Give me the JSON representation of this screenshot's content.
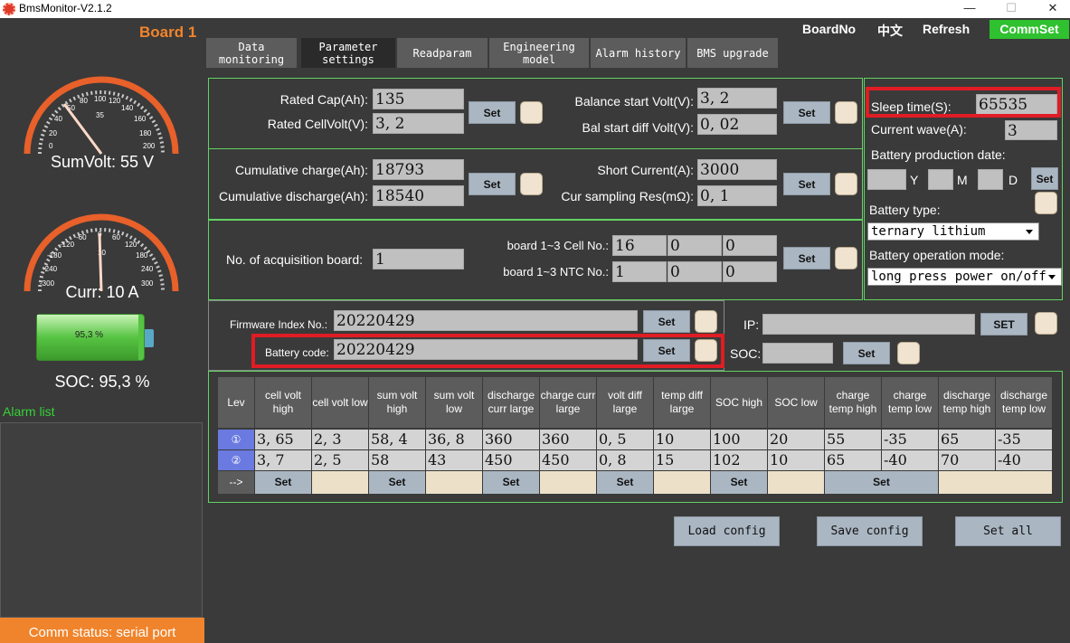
{
  "titlebar": {
    "title": "BmsMonitor-V2.1.2",
    "min": "—",
    "max": "☐",
    "close": "✕"
  },
  "board_label": "Board 1",
  "gauge_volt": {
    "ticks": [
      "0",
      "20",
      "40",
      "50",
      "80",
      "100",
      "120",
      "140",
      "160",
      "180",
      "200",
      "35"
    ],
    "label": "SumVolt: 55 V",
    "value": 55
  },
  "gauge_curr": {
    "ticks": [
      "-300",
      "-240",
      "-180",
      "-120",
      "-60",
      "0",
      "60",
      "120",
      "180",
      "240",
      "300",
      "10"
    ],
    "label": "Curr: 10 A",
    "value": 10
  },
  "battery": {
    "text": "95,3 %",
    "label": "SOC: 95,3 %",
    "level": 0.953
  },
  "alarm_list_label": "Alarm list",
  "comm_status": "Comm status: serial port",
  "tabs": [
    "Data monitoring",
    "Parameter settings",
    "Readparam",
    "Engineering model",
    "Alarm history",
    "BMS upgrade"
  ],
  "top_buttons": {
    "boardno": "BoardNo",
    "lang": "中文",
    "refresh": "Refresh",
    "commset": "CommSet"
  },
  "colors": {
    "accent_orange": "#f0842c",
    "panel_green": "#63d363",
    "alarm_red": "#e01c24",
    "commset_green": "#2fc12f"
  },
  "p1": {
    "rated_cap_label": "Rated Cap(Ah):",
    "rated_cap": "135",
    "rated_cellvolt_label": "Rated CellVolt(V):",
    "rated_cellvolt": "3, 2",
    "bal_start_label": "Balance start Volt(V):",
    "bal_start": "3, 2",
    "bal_diff_label": "Bal start diff Volt(V):",
    "bal_diff": "0, 02"
  },
  "p2": {
    "cum_charge_label": "Cumulative charge(Ah):",
    "cum_charge": "18793",
    "cum_discharge_label": "Cumulative discharge(Ah):",
    "cum_discharge": "18540",
    "short_label": "Short Current(A):",
    "short": "3000",
    "cursamp_label": "Cur sampling Res(mΩ):",
    "cursamp": "0, 1"
  },
  "p3": {
    "acq_label": "No. of acquisition board:",
    "acq": "1",
    "cellno_label": "board 1~3 Cell No.:",
    "cellno": [
      "16",
      "0",
      "0"
    ],
    "ntcno_label": "board 1~3 NTC No.:",
    "ntcno": [
      "1",
      "0",
      "0"
    ]
  },
  "right": {
    "sleep_label": "Sleep time(S):",
    "sleep": "65535",
    "wave_label": "Current wave(A):",
    "wave": "3",
    "prod_label": "Battery production date:",
    "y": "Y",
    "m": "M",
    "d": "D",
    "type_label": "Battery type:",
    "type": "ternary lithium",
    "mode_label": "Battery operation mode:",
    "mode": "long press power on/off"
  },
  "p4": {
    "fw_label": "Firmware Index No.:",
    "fw": "20220429",
    "code_label": "Battery code:",
    "code": "20220429"
  },
  "ipsoc": {
    "ip_label": "IP:",
    "ip": "",
    "soc_label": "SOC:",
    "soc": "",
    "set_upper": "SET"
  },
  "set_label": "Set",
  "table": {
    "headers": [
      "Lev",
      "cell volt high",
      "cell volt low",
      "sum volt high",
      "sum volt low",
      "discharge curr large",
      "charge curr large",
      "volt diff large",
      "temp diff large",
      "SOC high",
      "SOC low",
      "charge temp high",
      "charge temp low",
      "discharge temp high",
      "discharge temp low"
    ],
    "row1_icon": "①",
    "row2_icon": "②",
    "row3_label": "-->",
    "row1": [
      "3, 65",
      "2, 3",
      "58, 4",
      "36, 8",
      "360",
      "360",
      "0, 5",
      "10",
      "100",
      "20",
      "55",
      "-35",
      "65",
      "-35"
    ],
    "row2": [
      "3, 7",
      "2, 5",
      "58",
      "43",
      "450",
      "450",
      "0, 8",
      "15",
      "102",
      "10",
      "65",
      "-40",
      "70",
      "-40"
    ]
  },
  "bottom_buttons": {
    "load": "Load config",
    "save": "Save config",
    "setall": "Set all"
  }
}
